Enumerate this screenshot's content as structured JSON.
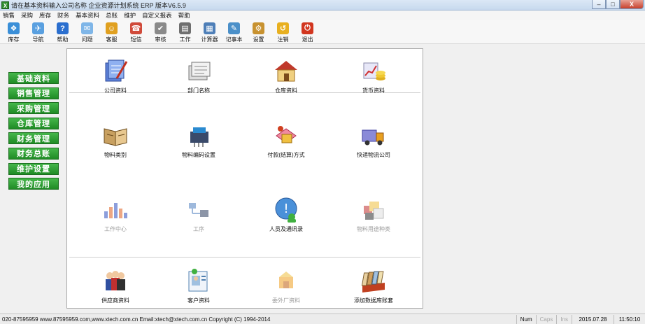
{
  "window": {
    "title": "请在基本资料输入公司名称 企业资源计划系统 ERP 版本V6.5.9",
    "app_icon": "X",
    "controls": {
      "minimize": "–",
      "maximize": "□",
      "close": "X"
    }
  },
  "menu": [
    "销售",
    "采购",
    "库存",
    "财务",
    "基本资料",
    "总账",
    "维护",
    "自定义报表",
    "帮助"
  ],
  "toolbar": [
    {
      "label": "库存",
      "icon": "inventory-icon",
      "color": "#3a8fd8",
      "glyph": "❖"
    },
    {
      "label": "导航",
      "icon": "navigation-icon",
      "color": "#5aa0e0",
      "glyph": "✈"
    },
    {
      "label": "帮助",
      "icon": "help-icon",
      "color": "#2b6fcf",
      "glyph": "?"
    },
    {
      "label": "问题",
      "icon": "question-icon",
      "color": "#7fb6e8",
      "glyph": "✉"
    },
    {
      "label": "客服",
      "icon": "service-icon",
      "color": "#e0a020",
      "glyph": "☺"
    },
    {
      "label": "短信",
      "icon": "sms-icon",
      "color": "#d04a3a",
      "glyph": "☎"
    },
    {
      "label": "审核",
      "icon": "audit-icon",
      "color": "#8a8a8a",
      "glyph": "✔"
    },
    {
      "label": "工作",
      "icon": "work-icon",
      "color": "#6f6f6f",
      "glyph": "▤"
    },
    {
      "label": "计算器",
      "icon": "calculator-icon",
      "color": "#4e7fb8",
      "glyph": "▦"
    },
    {
      "label": "记事本",
      "icon": "notepad-icon",
      "color": "#4b90c9",
      "glyph": "✎"
    },
    {
      "label": "设置",
      "icon": "settings-icon",
      "color": "#c89230",
      "glyph": "⚙"
    },
    {
      "label": "注销",
      "icon": "logout-icon",
      "color": "#e8b020",
      "glyph": "↺"
    },
    {
      "label": "退出",
      "icon": "exit-icon",
      "color": "#d2361f",
      "glyph": "⏻"
    }
  ],
  "sidebar": [
    "基础资料",
    "销售管理",
    "采购管理",
    "仓库管理",
    "财务管理",
    "财务总账",
    "维护设置",
    "我的应用"
  ],
  "modules": [
    {
      "label": "公司资料",
      "icon": "company-info-icon",
      "enabled": true
    },
    {
      "label": "部门名称",
      "icon": "department-icon",
      "enabled": true
    },
    {
      "label": "仓库资料",
      "icon": "warehouse-icon",
      "enabled": true
    },
    {
      "label": "货币资料",
      "icon": "currency-icon",
      "enabled": true
    },
    {
      "label": "物料类别",
      "icon": "material-category-icon",
      "enabled": true
    },
    {
      "label": "物料编码设置",
      "icon": "material-code-icon",
      "enabled": true
    },
    {
      "label": "付款(结算)方式",
      "icon": "payment-method-icon",
      "enabled": true
    },
    {
      "label": "快递物流公司",
      "icon": "logistics-icon",
      "enabled": true
    },
    {
      "label": "工作中心",
      "icon": "work-center-icon",
      "enabled": false
    },
    {
      "label": "工序",
      "icon": "process-icon",
      "enabled": false
    },
    {
      "label": "人员及通讯录",
      "icon": "contacts-icon",
      "enabled": true
    },
    {
      "label": "物料用途种类",
      "icon": "material-usage-icon",
      "enabled": false
    },
    {
      "label": "供应商资料",
      "icon": "supplier-icon",
      "enabled": true
    },
    {
      "label": "客户资料",
      "icon": "customer-icon",
      "enabled": true
    },
    {
      "label": "委外厂资料",
      "icon": "outsource-icon",
      "enabled": false
    },
    {
      "label": "添加数据库账套",
      "icon": "database-icon",
      "enabled": true
    }
  ],
  "status": {
    "info": "020-87595959 www.87595959.com,www.xtech.com.cn Email:xtech@xtech.com.cn Copyright (C) 1994-2014",
    "num": "Num",
    "caps": "Caps",
    "ins": "Ins",
    "date": "2015.07.28",
    "time": "11:50:10"
  },
  "colors": {
    "sidebar_green": "#2a9a30",
    "titlebar": "#c7d9ee"
  }
}
